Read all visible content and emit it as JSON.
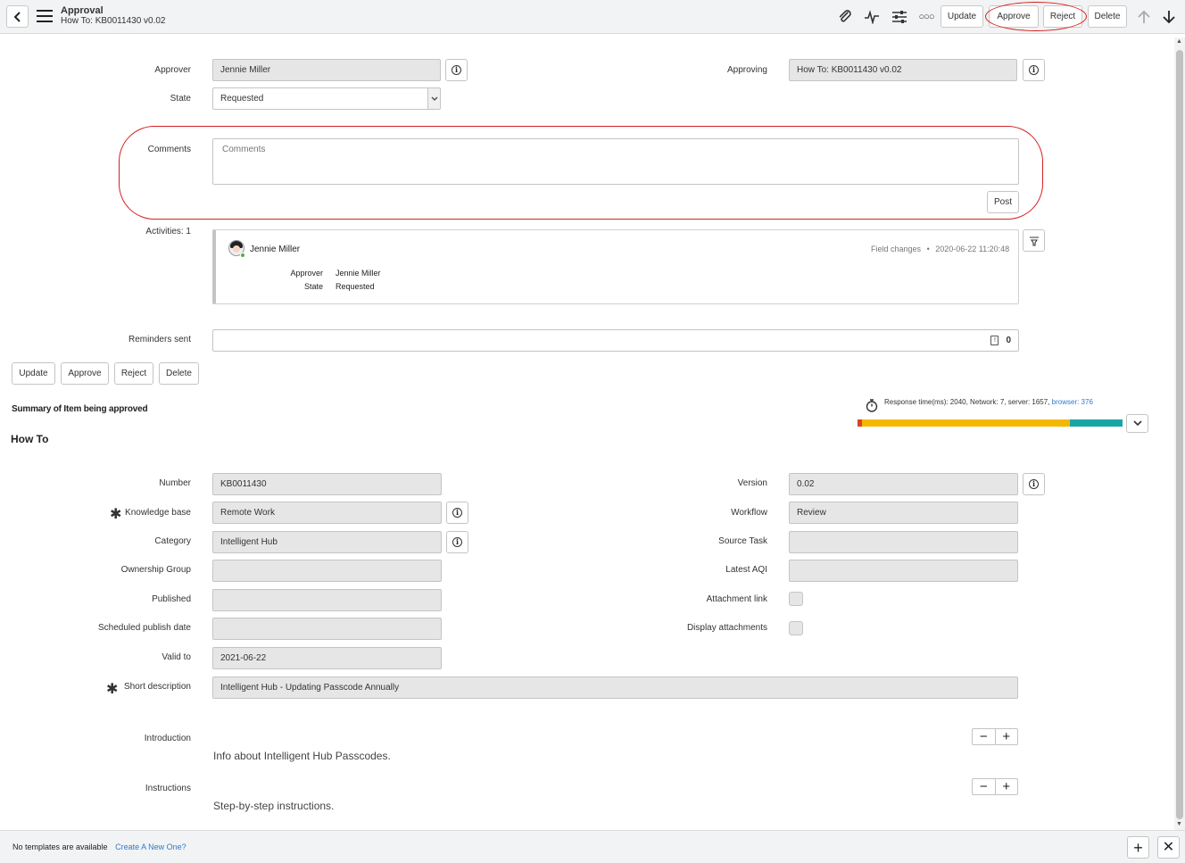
{
  "header": {
    "title": "Approval",
    "subtitle": "How To: KB0011430 v0.02",
    "buttons": {
      "update": "Update",
      "approve": "Approve",
      "reject": "Reject",
      "delete": "Delete"
    },
    "icons": [
      "paperclip-icon",
      "activity-icon",
      "settings-sliders-icon",
      "more-icon",
      "arrow-up-icon",
      "arrow-down-icon"
    ]
  },
  "form": {
    "approver_label": "Approver",
    "approver_value": "Jennie Miller",
    "approving_label": "Approving",
    "approving_value": "How To: KB0011430 v0.02",
    "state_label": "State",
    "state_value": "Requested",
    "comments_label": "Comments",
    "comments_placeholder": "Comments",
    "post_label": "Post",
    "activities_label": "Activities: 1",
    "activity": {
      "user": "Jennie Miller",
      "type": "Field changes",
      "dot": "•",
      "timestamp": "2020-06-22 11:20:48",
      "changes": [
        {
          "field": "Approver",
          "value": "Jennie Miller"
        },
        {
          "field": "State",
          "value": "Requested"
        }
      ]
    },
    "reminders_label": "Reminders sent",
    "reminders_value": "0"
  },
  "bottom_buttons": {
    "update": "Update",
    "approve": "Approve",
    "reject": "Reject",
    "delete": "Delete"
  },
  "summary": {
    "heading": "Summary of Item being approved",
    "type": "How To",
    "response_time_text": "Response time(ms): 2040, Network: 7, server: 1657,",
    "browser_link": "browser: 376",
    "timing_bar": {
      "network_pct": 1.7,
      "server_pct": 78.3,
      "browser_pct": 20.0
    }
  },
  "kb": {
    "number_label": "Number",
    "number_value": "KB0011430",
    "knowledge_base_label": "Knowledge base",
    "knowledge_base_value": "Remote Work",
    "category_label": "Category",
    "category_value": "Intelligent Hub",
    "ownership_label": "Ownership Group",
    "ownership_value": "",
    "published_label": "Published",
    "published_value": "",
    "scheduled_label": "Scheduled publish date",
    "scheduled_value": "",
    "valid_label": "Valid to",
    "valid_value": "2021-06-22",
    "short_desc_label": "Short description",
    "short_desc_value": "Intelligent Hub - Updating Passcode Annually",
    "version_label": "Version",
    "version_value": "0.02",
    "workflow_label": "Workflow",
    "workflow_value": "Review",
    "source_task_label": "Source Task",
    "source_task_value": "",
    "latest_aqi_label": "Latest AQI",
    "latest_aqi_value": "",
    "attachment_link_label": "Attachment link",
    "display_attachments_label": "Display attachments",
    "intro_label": "Introduction",
    "intro_text": "Info about Intelligent Hub Passcodes.",
    "instructions_label": "Instructions",
    "instructions_text": "Step-by-step instructions."
  },
  "footer": {
    "text": "No templates are available",
    "link": "Create A New One?"
  },
  "colors": {
    "accent_link": "#2e7bcf",
    "annotation_red": "#d62020",
    "bar_red": "#d9422b",
    "bar_yellow": "#f5b800",
    "bar_teal": "#1aa5a5"
  }
}
